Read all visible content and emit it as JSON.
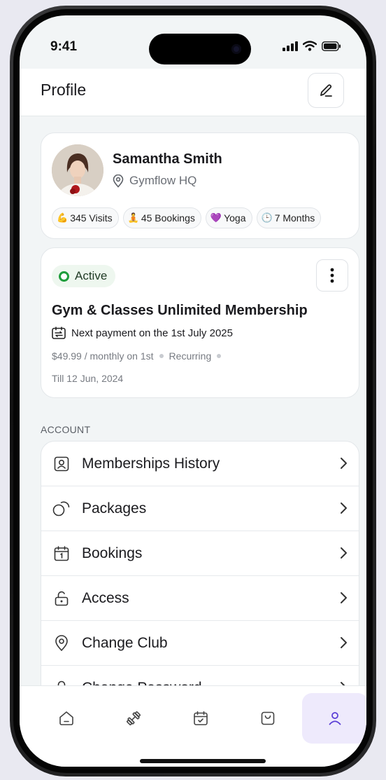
{
  "status_bar": {
    "time": "9:41"
  },
  "header": {
    "title": "Profile"
  },
  "profile": {
    "name": "Samantha Smith",
    "location": "Gymflow HQ",
    "chips": [
      {
        "icon": "💪",
        "label": "345 Visits"
      },
      {
        "icon": "🧘",
        "label": "45 Bookings"
      },
      {
        "icon": "💜",
        "label": "Yoga"
      },
      {
        "icon": "🕒",
        "label": "7 Months"
      }
    ]
  },
  "membership": {
    "status": "Active",
    "title": "Gym & Classes Unlimited Membership",
    "next_payment": "Next payment on the 1st July 2025",
    "price": "$49.99 / monthly on 1st",
    "type": "Recurring",
    "till": "Till 12 Jun, 2024"
  },
  "account": {
    "heading": "ACCOUNT",
    "items": [
      {
        "label": "Memberships History"
      },
      {
        "label": "Packages"
      },
      {
        "label": "Bookings"
      },
      {
        "label": "Access"
      },
      {
        "label": "Change Club"
      },
      {
        "label": "Change Password"
      }
    ]
  },
  "colors": {
    "accent": "#5b3fd6",
    "active_green": "#1f9d3c",
    "active_tab_bg": "#eeeafc"
  }
}
